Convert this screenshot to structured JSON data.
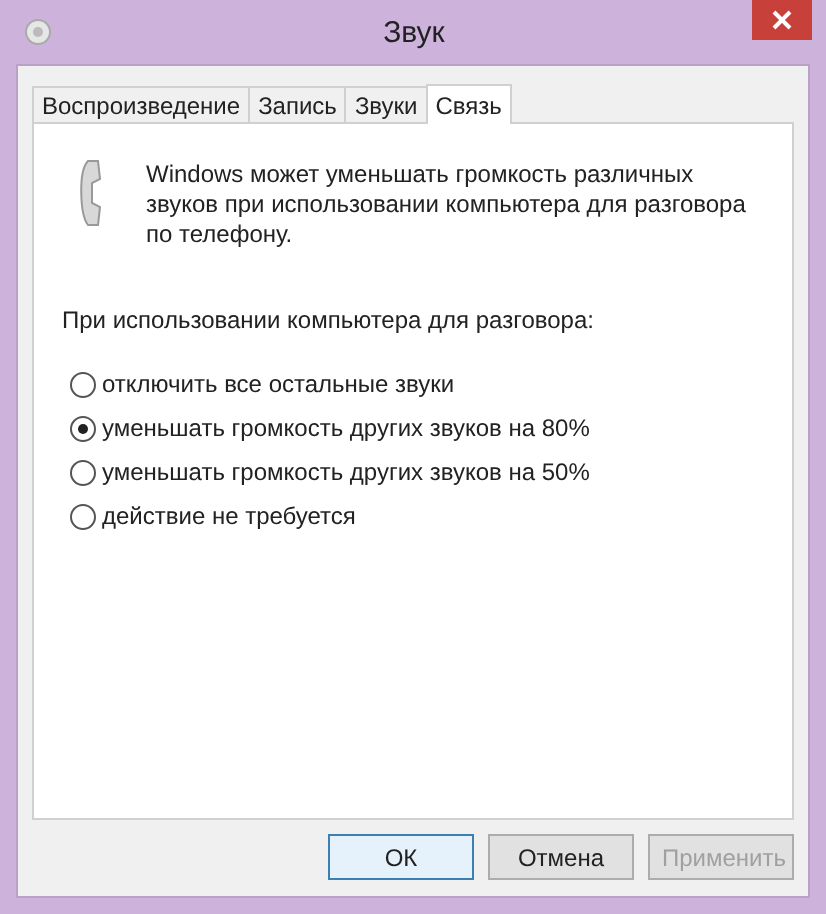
{
  "window": {
    "title": "Звук"
  },
  "tabs": [
    {
      "label": "Воспроизведение",
      "selected": false
    },
    {
      "label": "Запись",
      "selected": false
    },
    {
      "label": "Звуки",
      "selected": false
    },
    {
      "label": "Связь",
      "selected": true
    }
  ],
  "description": "Windows может уменьшать громкость различных звуков при использовании компьютера для разговора по телефону.",
  "group_label": "При использовании компьютера для разговора:",
  "options": [
    {
      "label": "отключить все остальные звуки",
      "selected": false
    },
    {
      "label": "уменьшать громкость других звуков на 80%",
      "selected": true
    },
    {
      "label": "уменьшать громкость других звуков на 50%",
      "selected": false
    },
    {
      "label": "действие не требуется",
      "selected": false
    }
  ],
  "buttons": [
    {
      "label": "ОК",
      "default": true,
      "disabled": false
    },
    {
      "label": "Отмена",
      "default": false,
      "disabled": false
    },
    {
      "label": "Применить",
      "default": false,
      "disabled": true
    }
  ]
}
